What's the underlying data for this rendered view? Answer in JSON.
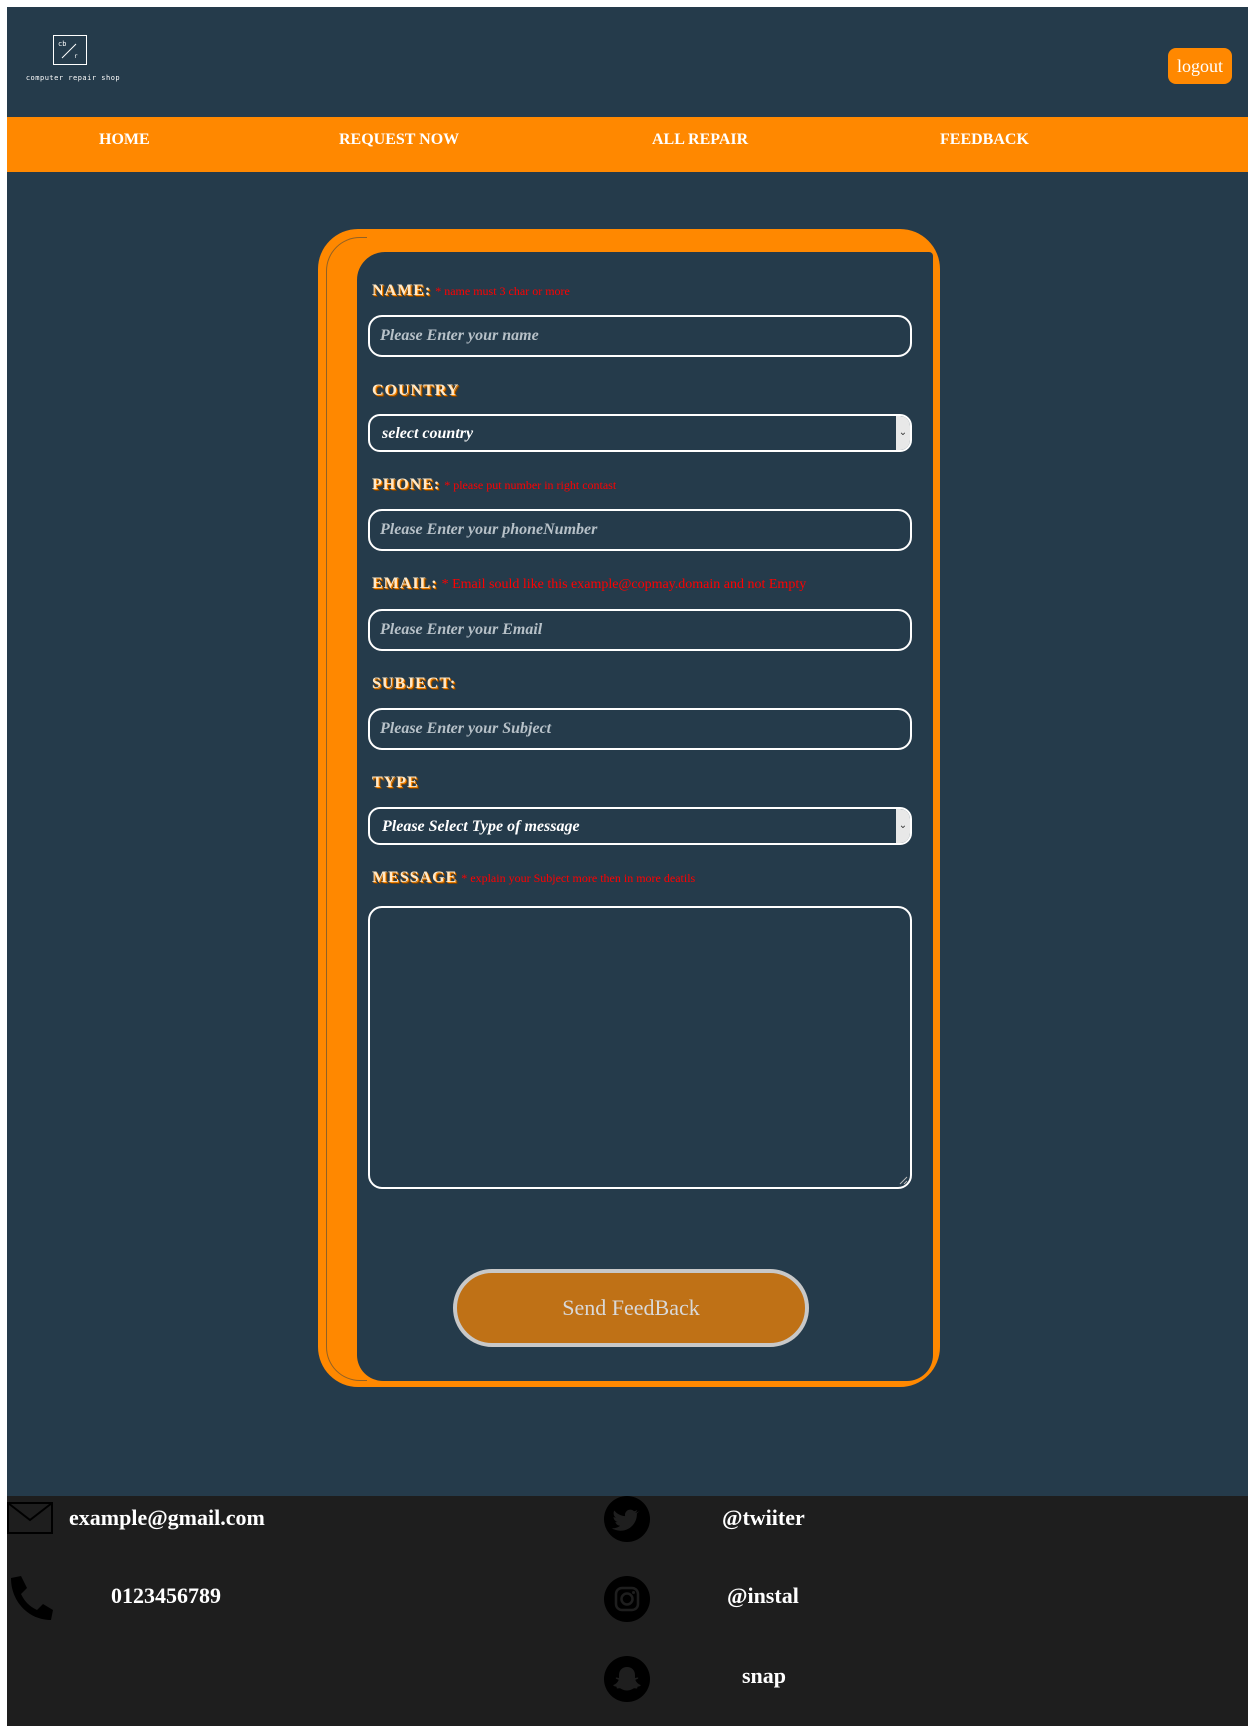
{
  "header": {
    "logo_text": "computer repair shop",
    "logout_label": "logout"
  },
  "nav": [
    {
      "label": "HOME"
    },
    {
      "label": "REQUEST NOW"
    },
    {
      "label": "ALL REPAIR"
    },
    {
      "label": "FEEDBACK"
    }
  ],
  "form": {
    "name": {
      "label": "NAME:",
      "hint": "* name must 3 char or more",
      "placeholder": "Please Enter your name"
    },
    "country": {
      "label": "COUNTRY",
      "selected": "select country"
    },
    "phone": {
      "label": "PHONE:",
      "hint": "* please put number in right contast",
      "placeholder": "Please Enter your phoneNumber"
    },
    "email": {
      "label": "EMAIL:",
      "hint": "* Email sould like this example@copmay.domain and not Empty",
      "placeholder": "Please Enter your Email"
    },
    "subject": {
      "label": "SUBJECT:",
      "placeholder": "Please Enter your Subject"
    },
    "type": {
      "label": "TYPE",
      "selected": "Please Select Type of message"
    },
    "message": {
      "label": "MESSAGE",
      "hint": "* explain your Subject more then in more deatils"
    },
    "send_label": "Send FeedBack"
  },
  "footer": {
    "email": "example@gmail.com",
    "phone": "0123456789",
    "twitter": "@twiiter",
    "instagram": "@instal",
    "snapchat": "snap"
  },
  "colors": {
    "background": "#253b4b",
    "accent": "#ff8800",
    "footer": "#1e1e1e",
    "error": "#ff0000",
    "button": "#bf7116"
  },
  "icons": [
    "logo-icon",
    "chevron-down-icon",
    "envelope-icon",
    "phone-icon",
    "twitter-icon",
    "instagram-icon",
    "snapchat-icon",
    "resize-handle-icon"
  ]
}
